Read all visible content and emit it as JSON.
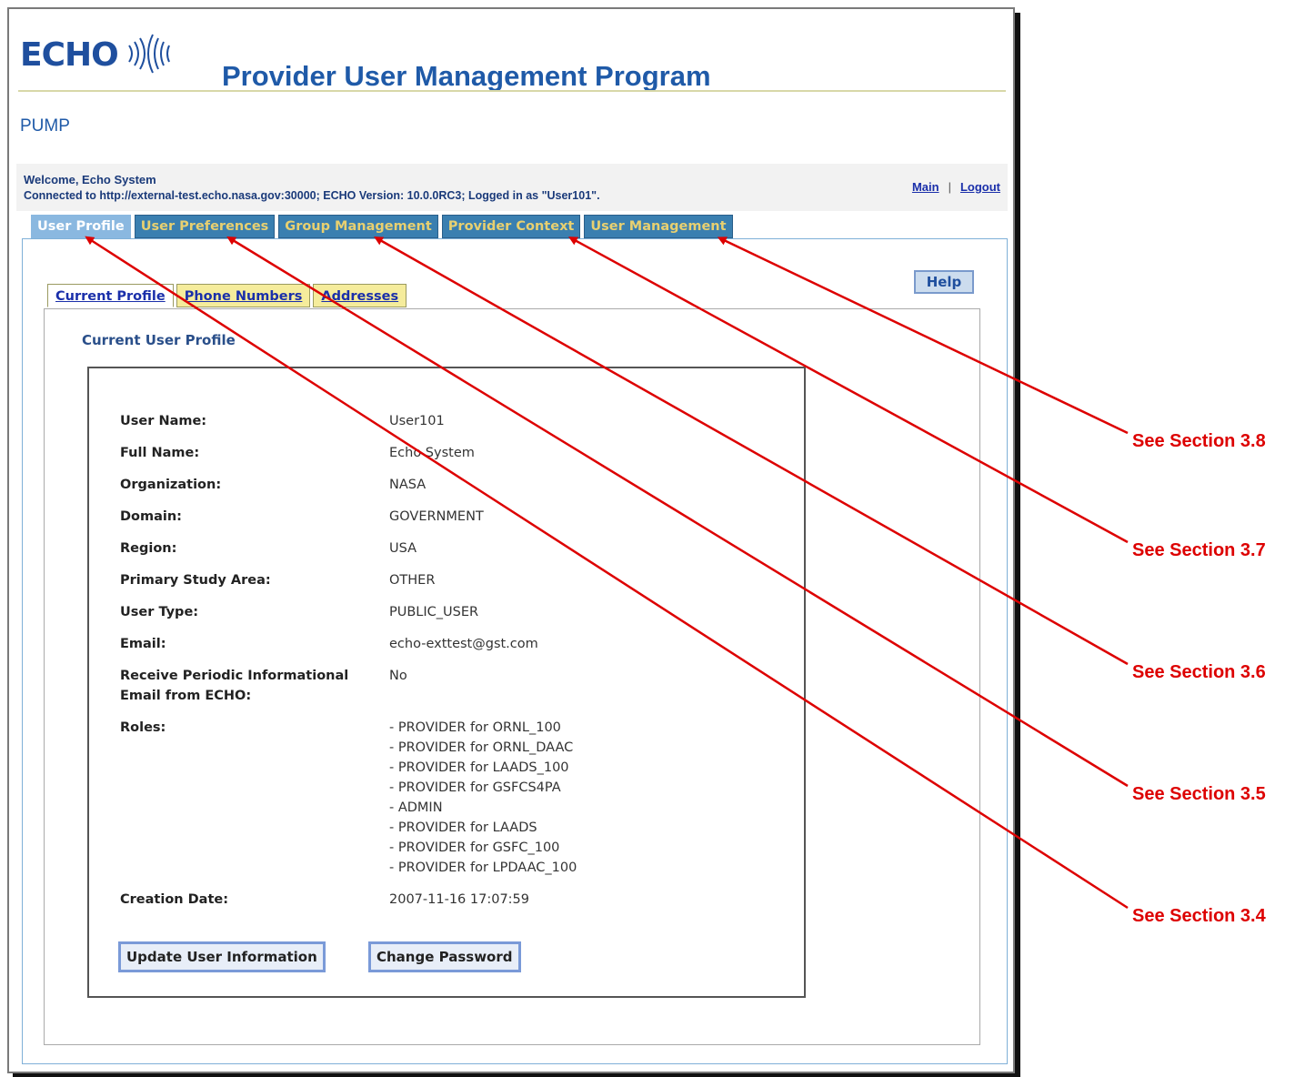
{
  "header": {
    "logo_text": "ECHO",
    "title": "Provider User Management Program",
    "short_name": "PUMP"
  },
  "status": {
    "welcome": "Welcome, Echo System",
    "connection": "Connected to http://external-test.echo.nasa.gov:30000; ECHO Version: 10.0.0RC3; Logged in as \"User101\".",
    "main_link": "Main",
    "separator": "|",
    "logout_link": "Logout"
  },
  "main_tabs": [
    {
      "label": "User Profile",
      "active": true
    },
    {
      "label": "User Preferences",
      "active": false
    },
    {
      "label": "Group Management",
      "active": false
    },
    {
      "label": "Provider Context",
      "active": false
    },
    {
      "label": "User Management",
      "active": false
    }
  ],
  "help_label": "Help",
  "sub_tabs": [
    {
      "label": "Current Profile",
      "active": true
    },
    {
      "label": "Phone Numbers",
      "active": false
    },
    {
      "label": "Addresses",
      "active": false
    }
  ],
  "section_title": "Current User Profile",
  "profile": {
    "user_name_label": "User Name:",
    "user_name": "User101",
    "full_name_label": "Full Name:",
    "full_name": "Echo System",
    "organization_label": "Organization:",
    "organization": "NASA",
    "domain_label": "Domain:",
    "domain": "GOVERNMENT",
    "region_label": "Region:",
    "region": "USA",
    "study_area_label": "Primary Study Area:",
    "study_area": "OTHER",
    "user_type_label": "User Type:",
    "user_type": "PUBLIC_USER",
    "email_label": "Email:",
    "email": "echo-exttest@gst.com",
    "periodic_label_1": "Receive Periodic Informational",
    "periodic_label_2": "Email from ECHO:",
    "periodic": "No",
    "roles_label": "Roles:",
    "roles": [
      "- PROVIDER for ORNL_100",
      "- PROVIDER for ORNL_DAAC",
      "- PROVIDER for LAADS_100",
      "- PROVIDER for GSFCS4PA",
      "- ADMIN",
      "- PROVIDER for LAADS",
      "- PROVIDER for GSFC_100",
      "- PROVIDER for LPDAAC_100"
    ],
    "creation_label": "Creation Date:",
    "creation_date": "2007-11-16 17:07:59"
  },
  "buttons": {
    "update": "Update User Information",
    "change_password": "Change Password"
  },
  "callouts": [
    "See Section 3.8",
    "See Section 3.7",
    "See Section 3.6",
    "See Section 3.5",
    "See Section 3.4"
  ],
  "colors": {
    "annotation": "#dd0000",
    "tab_bg": "#3a7fb0",
    "tab_text": "#e8d070",
    "active_tab": "#8ab8e0",
    "subtab_bg": "#f5ec9c",
    "title_blue": "#1f5aa8"
  }
}
